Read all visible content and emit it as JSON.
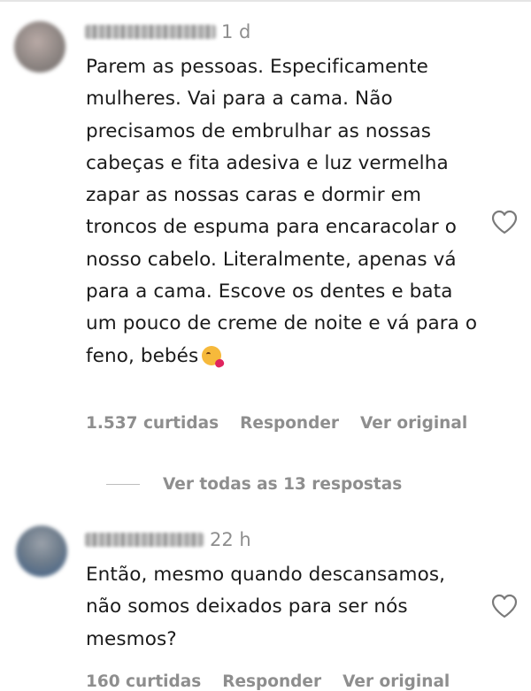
{
  "comments": [
    {
      "time": "1 d",
      "text": "Parem as pessoas. Especificamente mulheres. Vai para a cama. Não precisamos de embrulhar as nossas cabeças e fita adesiva e luz vermelha zapar as nossas caras e dormir em troncos de espuma para encaracolar o nosso cabelo. Literalmente, apenas vá para a cama. Escove os dentes e bata um pouco de creme de noite e vá para o feno, bebés",
      "emoji_icon": "kissing-heart-emoji",
      "likes": "1.537 curtidas",
      "reply_label": "Responder",
      "original_label": "Ver original",
      "view_replies": "Ver todas as 13 respostas"
    },
    {
      "time": "22 h",
      "text": "Então, mesmo quando descansamos, não somos deixados para ser nós mesmos?",
      "likes": "160 curtidas",
      "reply_label": "Responder",
      "original_label": "Ver original"
    }
  ],
  "icons": {
    "like": "heart-outline-icon"
  },
  "colors": {
    "secondary_text": "#8e8e8e",
    "primary_text": "#1a1a1a"
  }
}
